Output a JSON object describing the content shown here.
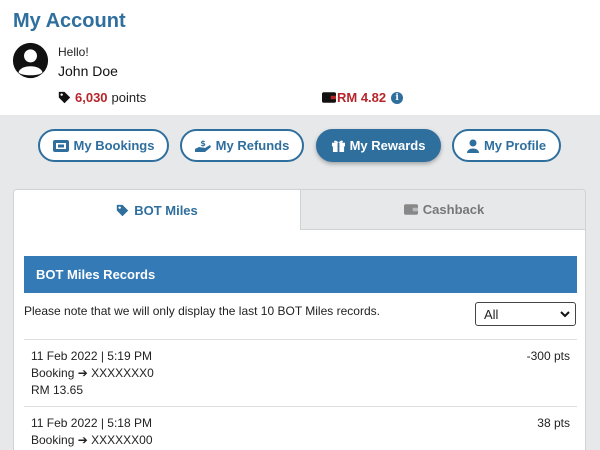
{
  "header": {
    "title": "My Account",
    "greeting": "Hello!",
    "user_name": "John Doe",
    "points_value": "6,030",
    "points_unit": "points",
    "wallet_amount": "RM 4.82"
  },
  "nav": {
    "bookings": "My Bookings",
    "refunds": "My Refunds",
    "rewards": "My Rewards",
    "profile": "My Profile",
    "active": "rewards"
  },
  "tabs": {
    "miles": "BOT Miles",
    "cashback": "Cashback",
    "active": "miles"
  },
  "records": {
    "heading": "BOT Miles Records",
    "note": "Please note that we will only display the last 10 BOT Miles records.",
    "filter_selected": "All",
    "items": [
      {
        "datetime": "11 Feb 2022 | 5:19 PM",
        "booking_label": "Booking",
        "booking_ref": "XXXXXXX0",
        "amount": "RM 13.65",
        "points": "-300 pts"
      },
      {
        "datetime": "11 Feb 2022 | 5:18 PM",
        "booking_label": "Booking",
        "booking_ref": "XXXXXX00",
        "points": "38 pts"
      }
    ]
  },
  "colors": {
    "primary": "#2f6f9e",
    "header_bar": "#337ab7",
    "accent_red": "#b7252b",
    "background_gray": "#e6e8ea"
  }
}
